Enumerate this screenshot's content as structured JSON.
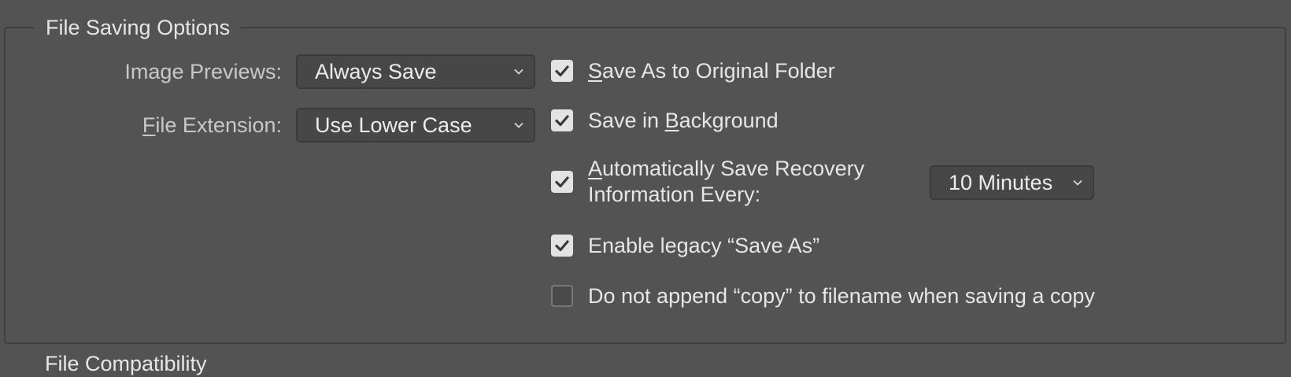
{
  "section": {
    "title": "File Saving Options"
  },
  "image_previews": {
    "label_pre": "Ima",
    "label_u": "g",
    "label_post": "e Previews:",
    "value": "Always Save"
  },
  "file_extension": {
    "label_u": "F",
    "label_post": "ile Extension:",
    "value": "Use Lower Case"
  },
  "checkboxes": {
    "save_as_original": {
      "u": "S",
      "post": "ave As to Original Folder",
      "checked": true
    },
    "save_background": {
      "pre": "Save in ",
      "u": "B",
      "post": "ackground",
      "checked": true
    },
    "auto_recovery": {
      "line1_u": "A",
      "line1_post": "utomatically Save Recovery",
      "line2": "Information Every:",
      "checked": true,
      "interval": "10 Minutes"
    },
    "legacy_save_as": {
      "label": "Enable legacy “Save As”",
      "checked": true
    },
    "no_copy_append": {
      "label": "Do not append “copy” to filename when saving a copy",
      "checked": false
    }
  },
  "next_section": {
    "title": "File Compatibility"
  },
  "colors": {
    "background": "#535353",
    "field": "#474747",
    "checkbox_checked": "#e3e3e3"
  }
}
